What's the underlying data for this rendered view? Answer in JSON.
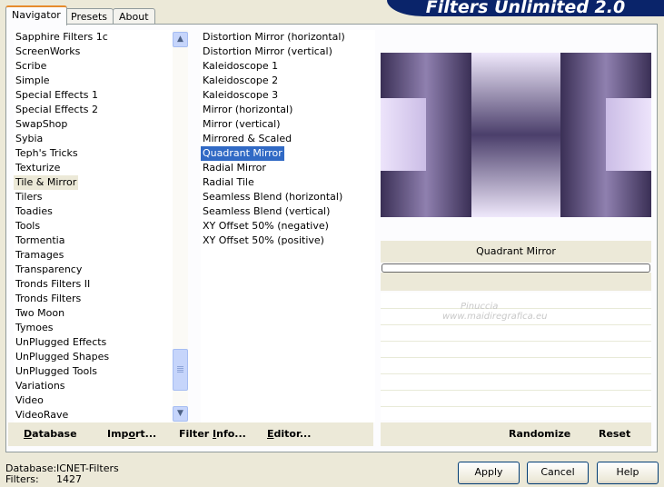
{
  "tabs": [
    {
      "label": "Navigator",
      "active": true
    },
    {
      "label": "Presets",
      "active": false
    },
    {
      "label": "About",
      "active": false
    }
  ],
  "banner_title": "Filters Unlimited 2.0",
  "categories": [
    "Sapphire Filters 1c",
    "ScreenWorks",
    "Scribe",
    "Simple",
    "Special Effects 1",
    "Special Effects 2",
    "SwapShop",
    "Sybia",
    "Teph's Tricks",
    "Texturize",
    "Tile & Mirror",
    "Tilers",
    "Toadies",
    "Tools",
    "Tormentia",
    "Tramages",
    "Transparency",
    "Tronds Filters II",
    "Tronds Filters",
    "Two Moon",
    "Tymoes",
    "UnPlugged Effects",
    "UnPlugged Shapes",
    "UnPlugged Tools",
    "Variations",
    "Video",
    "VideoRave"
  ],
  "selected_category": "Tile & Mirror",
  "filters": [
    "Distortion Mirror (horizontal)",
    "Distortion Mirror (vertical)",
    "Kaleidoscope 1",
    "Kaleidoscope 2",
    "Kaleidoscope 3",
    "Mirror (horizontal)",
    "Mirror (vertical)",
    "Mirrored & Scaled",
    "Quadrant Mirror",
    "Radial Mirror",
    "Radial Tile",
    "Seamless Blend (horizontal)",
    "Seamless Blend (vertical)",
    "XY Offset 50% (negative)",
    "XY Offset 50% (positive)"
  ],
  "selected_filter": "Quadrant Mirror",
  "preview_filter_name": "Quadrant Mirror",
  "watermark": {
    "line1": "Pinuccia",
    "line2": "www.maidiregrafica.eu"
  },
  "left_actions": {
    "database": {
      "pre": "",
      "u": "D",
      "post": "atabase"
    },
    "import": {
      "pre": "Imp",
      "u": "o",
      "post": "rt..."
    },
    "filter_info": {
      "pre": "Filter ",
      "u": "I",
      "post": "nfo..."
    },
    "editor": {
      "pre": "",
      "u": "E",
      "post": "ditor..."
    }
  },
  "right_actions": {
    "randomize": "Randomize",
    "reset": "Reset"
  },
  "status": {
    "database_label": "Database:",
    "database_value": "ICNET-Filters",
    "filters_label": "Filters:",
    "filters_value": "1427"
  },
  "buttons": {
    "apply": "Apply",
    "cancel": "Cancel",
    "help": "Help"
  },
  "colors": {
    "selection_blue": "#316ac5",
    "banner_blue": "#0a246a",
    "preview_dark": "#4b3f6b",
    "preview_light": "#e6dcf7"
  }
}
